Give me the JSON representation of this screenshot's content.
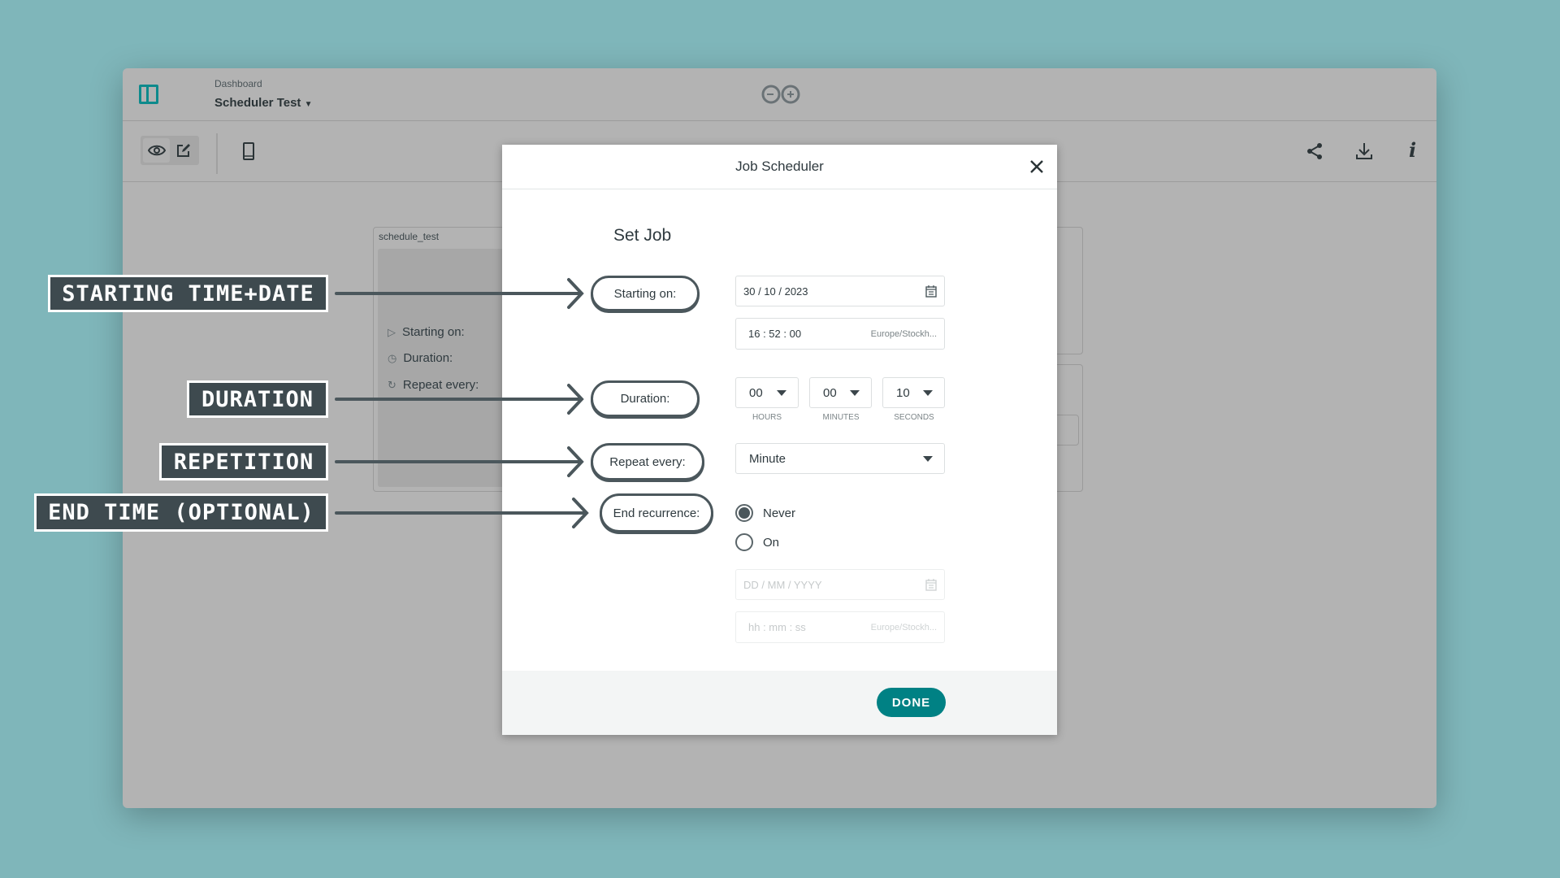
{
  "colors": {
    "background": "#7fb6ba",
    "accent": "#008184",
    "annotation": "#3e4a4f"
  },
  "header": {
    "breadcrumb": "Dashboard",
    "title": "Scheduler Test",
    "logo": "arduino-infinity-logo"
  },
  "toolbar": {
    "icons": [
      "eye-icon",
      "edit-icon",
      "phone-icon",
      "share-icon",
      "download-icon",
      "info-icon"
    ]
  },
  "widget": {
    "title": "schedule_test",
    "rows": [
      {
        "icon": "play-icon",
        "label": "Starting on:"
      },
      {
        "icon": "clock-icon",
        "label": "Duration:"
      },
      {
        "icon": "repeat-icon",
        "label": "Repeat every:"
      }
    ]
  },
  "modal": {
    "title": "Job Scheduler",
    "heading": "Set Job",
    "labels": {
      "start": "Starting on:",
      "duration": "Duration:",
      "repeat": "Repeat every:",
      "end": "End recurrence:"
    },
    "start_date": "30 / 10 / 2023",
    "start_time": "16 : 52 : 00",
    "timezone": "Europe/Stockh...",
    "duration": {
      "hours": "00",
      "minutes": "00",
      "seconds": "10",
      "hours_label": "HOURS",
      "minutes_label": "MINUTES",
      "seconds_label": "SECONDS"
    },
    "repeat": "Minute",
    "end_options": [
      {
        "label": "Never",
        "selected": true
      },
      {
        "label": "On",
        "selected": false
      }
    ],
    "end_date_placeholder": "DD / MM / YYYY",
    "end_time_placeholder": "hh : mm : ss",
    "done_label": "DONE"
  },
  "annotations": [
    "STARTING TIME+DATE",
    "DURATION",
    "REPETITION",
    "END TIME (OPTIONAL)"
  ]
}
